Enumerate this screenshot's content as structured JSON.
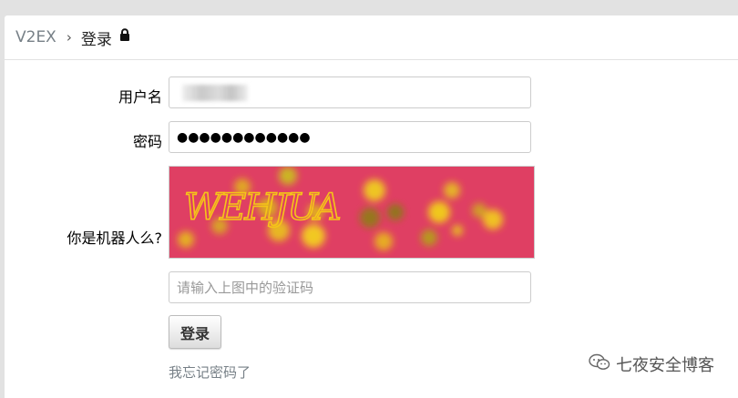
{
  "breadcrumb": {
    "home": "V2EX",
    "separator": "›",
    "current": "登录",
    "lock_icon": "lock-icon"
  },
  "form": {
    "username_label": "用户名",
    "password_label": "密码",
    "password_mask": "●●●●●●●●●●●●",
    "captcha_label": "你是机器人么?",
    "captcha_text": "WEHJUA",
    "captcha_placeholder": "请输入上图中的验证码",
    "submit_label": "登录",
    "forgot_link": "我忘记密码了"
  },
  "watermark": {
    "text": "七夜安全博客",
    "icon": "wechat-icon"
  },
  "colors": {
    "captcha_bg": "#df3f63",
    "captcha_text": "#f5c518",
    "link": "#778087"
  }
}
